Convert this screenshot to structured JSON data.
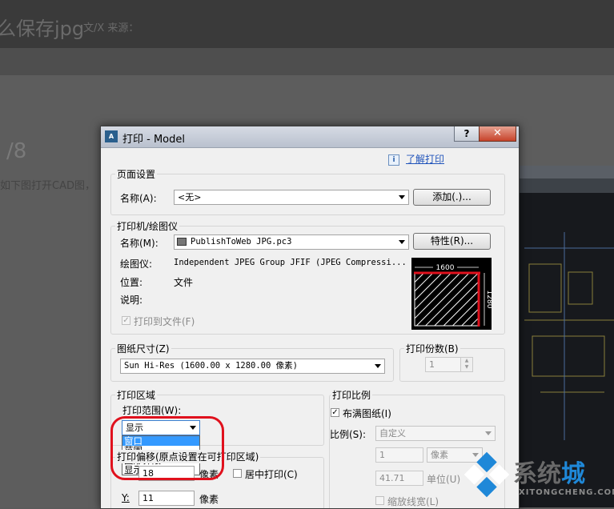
{
  "background": {
    "title_fragment": "么保存jpg",
    "meta_fragment": "文/X  来源：",
    "step": "/8",
    "text_fragment": "如下图打开CAD图，"
  },
  "dialog": {
    "title": "打印 - Model",
    "app_icon": "A",
    "help_button": "?",
    "close_button": "✕",
    "learn_link": "了解打印",
    "page_setup": {
      "group_label": "页面设置",
      "name_label": "名称(A):",
      "name_value": "<无>",
      "add_button": "添加(.)..."
    },
    "printer": {
      "group_label": "打印机/绘图仪",
      "name_label": "名称(M):",
      "name_value": "PublishToWeb JPG.pc3",
      "properties_button": "特性(R)...",
      "plotter_label": "绘图仪:",
      "plotter_value": "Independent JPEG Group JFIF (JPEG Compressi...",
      "location_label": "位置:",
      "location_value": "文件",
      "description_label": "说明:",
      "plot_to_file_label": "打印到文件(F)",
      "plot_to_file_checked": true,
      "preview_width": "1600",
      "preview_height": "1280"
    },
    "paper_size": {
      "group_label": "图纸尺寸(Z)",
      "value": "Sun Hi-Res (1600.00 x 1280.00 像素)"
    },
    "copies": {
      "group_label": "打印份数(B)",
      "value": "1"
    },
    "plot_area": {
      "group_label": "打印区域",
      "range_label": "打印范围(W):",
      "range_value": "显示",
      "options": [
        "窗口",
        "范围",
        "图形界限",
        "显示"
      ],
      "selected_option": "窗口"
    },
    "plot_offset": {
      "group_label_fragment": "打印偏移(原点设置在可打印区域)",
      "x_label": "X:",
      "x_value": "18",
      "x_unit": "像素",
      "center_label": "居中打印(C)",
      "y_label": "Y:",
      "y_value": "11",
      "y_unit": "像素"
    },
    "plot_scale": {
      "group_label": "打印比例",
      "fit_label": "布满图纸(I)",
      "fit_checked": true,
      "scale_label": "比例(S):",
      "scale_value": "自定义",
      "value1": "1",
      "unit1": "像素",
      "value2": "41.71",
      "unit2": "单位(U)",
      "lineweights_label": "缩放线宽(L)"
    }
  },
  "watermark": {
    "brand": "系统城",
    "url": "XITONGCHENG.COM"
  },
  "colors": {
    "annotation_red": "#e0111d",
    "selection_blue": "#3399ff",
    "watermark_blue": "#1f88d8"
  }
}
